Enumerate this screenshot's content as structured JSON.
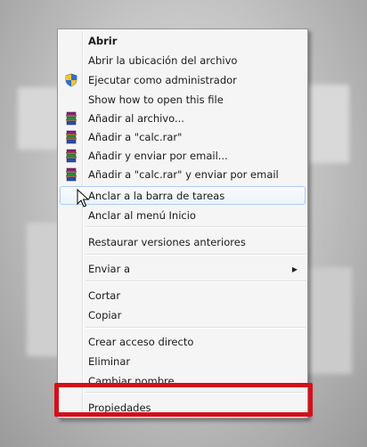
{
  "menu": {
    "items": [
      {
        "label": "Abrir",
        "bold": true,
        "icon": ""
      },
      {
        "label": "Abrir la ubicación del archivo",
        "icon": ""
      },
      {
        "label": "Ejecutar como administrador",
        "icon": "uac-shield-icon"
      },
      {
        "label": "Show how to open this file",
        "icon": ""
      },
      {
        "label": "Añadir al archivo...",
        "icon": "winrar-icon"
      },
      {
        "label": "Añadir a \"calc.rar\"",
        "icon": "winrar-icon"
      },
      {
        "label": "Añadir y enviar por email...",
        "icon": "winrar-icon"
      },
      {
        "label": "Añadir a \"calc.rar\" y enviar por email",
        "icon": "winrar-icon"
      },
      {
        "label": "Anclar a la barra de tareas",
        "icon": "",
        "hovered": true
      },
      {
        "label": "Anclar al menú Inicio",
        "icon": ""
      },
      {
        "label": "Restaurar versiones anteriores",
        "icon": ""
      },
      {
        "label": "Enviar a",
        "icon": "",
        "submenu": true
      },
      {
        "label": "Cortar",
        "icon": ""
      },
      {
        "label": "Copiar",
        "icon": ""
      },
      {
        "label": "Crear acceso directo",
        "icon": ""
      },
      {
        "label": "Eliminar",
        "icon": ""
      },
      {
        "label": "Cambiar nombre",
        "icon": ""
      },
      {
        "label": "Propiedades",
        "icon": "",
        "highlighted": true
      }
    ],
    "submenu_arrow": "▶"
  },
  "colors": {
    "highlight_border": "#d3101a",
    "hover_border": "#aeccf1",
    "menu_background": "#f5f5f5"
  }
}
